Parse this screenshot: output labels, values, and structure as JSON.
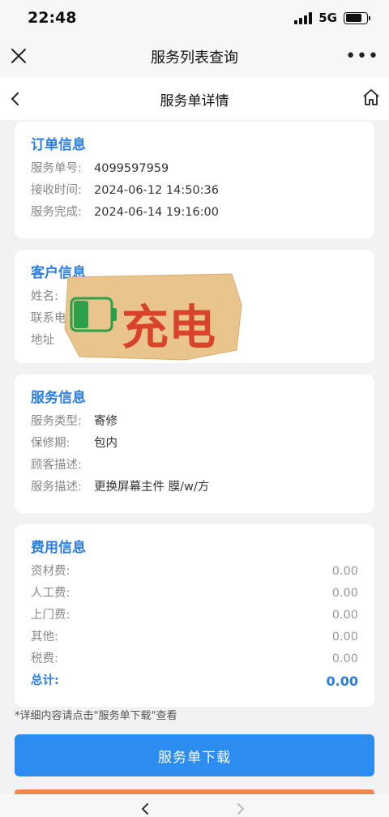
{
  "status_bar": {
    "time": "22:48",
    "network": "5G"
  },
  "title_bar": {
    "title": "服务列表查询"
  },
  "nav_bar": {
    "title": "服务单详情"
  },
  "order_info": {
    "title": "订单信息",
    "rows": [
      {
        "label": "服务单号:",
        "value": "4099597959"
      },
      {
        "label": "接收时间:",
        "value": "2024-06-12 14:50:36"
      },
      {
        "label": "服务完成:",
        "value": "2024-06-14 19:16:00"
      }
    ]
  },
  "customer_info": {
    "title": "客户信息",
    "rows": [
      {
        "label": "姓名:",
        "value": ""
      },
      {
        "label": "联系电",
        "value": ""
      },
      {
        "label": "地址",
        "value": ""
      }
    ]
  },
  "sticker": {
    "text": "充电"
  },
  "service_info": {
    "title": "服务信息",
    "rows": [
      {
        "label": "服务类型:",
        "value": "寄修"
      },
      {
        "label": "保修期:",
        "value": "包内"
      },
      {
        "label": "顾客描述:",
        "value": ""
      },
      {
        "label": "服务描述:",
        "value": "更换屏幕主件 膜/w/方"
      }
    ]
  },
  "fee_info": {
    "title": "费用信息",
    "rows": [
      {
        "label": "资材费:",
        "value": "0.00"
      },
      {
        "label": "人工费:",
        "value": "0.00"
      },
      {
        "label": "上门费:",
        "value": "0.00"
      },
      {
        "label": "其他:",
        "value": "0.00"
      },
      {
        "label": "税费:",
        "value": "0.00"
      }
    ],
    "total": {
      "label": "总计:",
      "value": "0.00"
    }
  },
  "note": "*详细内容请点击\"服务单下载\"查看",
  "download_button": "服务单下载",
  "colors": {
    "accent": "#2b7de1",
    "button": "#2d8cf0",
    "sticker_red": "#d8432b",
    "sticker_bg": "#e9c48d",
    "battery_green": "#2aa04a"
  }
}
